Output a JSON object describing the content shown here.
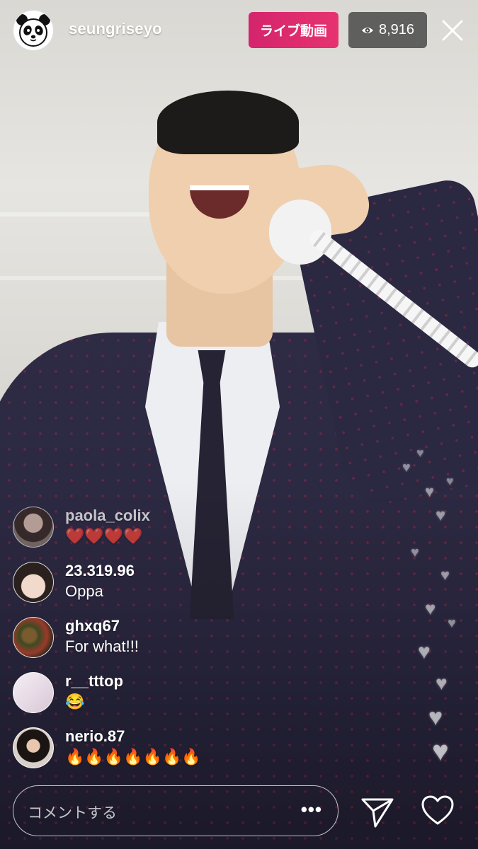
{
  "header": {
    "username": "seungriseyo",
    "live_label": "ライブ動画",
    "viewer_count": "8,916",
    "avatar_icon": "panda-icon",
    "live_color": "#d4246c"
  },
  "comments": [
    {
      "user": "paola_colix",
      "text": "❤️❤️❤️❤️"
    },
    {
      "user": "23.319.96",
      "text": "Oppa"
    },
    {
      "user": "ghxq67",
      "text": "For what!!!"
    },
    {
      "user": "r__tttop",
      "text": "😂"
    },
    {
      "user": "nerio.87",
      "text": "🔥🔥🔥🔥🔥🔥🔥"
    }
  ],
  "composer": {
    "placeholder": "コメントする",
    "more_label": "•••"
  },
  "icons": {
    "viewer": "eye-icon",
    "close": "close-icon",
    "send": "send-icon",
    "like": "heart-icon"
  }
}
